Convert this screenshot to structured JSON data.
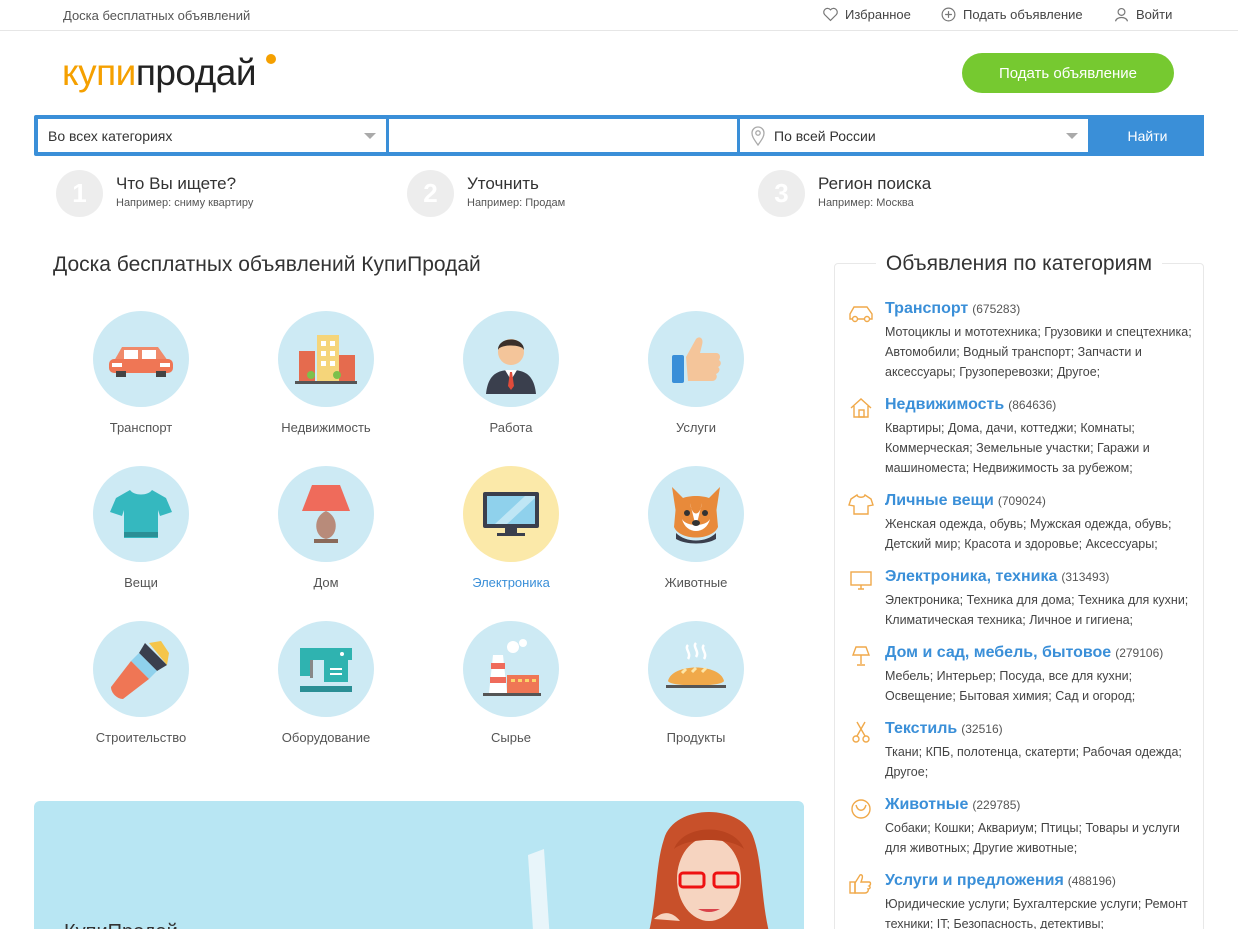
{
  "topbar": {
    "site_title": "Доска бесплатных объявлений",
    "favorites": "Избранное",
    "post_ad": "Подать объявление",
    "login": "Войти"
  },
  "logo": {
    "part1": "купи",
    "part2": "продай"
  },
  "header": {
    "post_button": "Подать объявление"
  },
  "search": {
    "category_value": "Во всех категориях",
    "query_value": "",
    "region_value": "По всей России",
    "submit": "Найти"
  },
  "steps": [
    {
      "num": "1",
      "title": "Что Вы ищете?",
      "hint": "Например: сниму квартиру"
    },
    {
      "num": "2",
      "title": "Уточнить",
      "hint": "Например: Продам"
    },
    {
      "num": "3",
      "title": "Регион поиска",
      "hint": "Например: Москва"
    }
  ],
  "main": {
    "heading": "Доска бесплатных объявлений КупиПродай",
    "categories": [
      {
        "label": "Транспорт",
        "icon": "car-icon"
      },
      {
        "label": "Недвижимость",
        "icon": "buildings-icon"
      },
      {
        "label": "Работа",
        "icon": "businessman-icon"
      },
      {
        "label": "Услуги",
        "icon": "thumbs-up-icon"
      },
      {
        "label": "Вещи",
        "icon": "tshirt-icon"
      },
      {
        "label": "Дом",
        "icon": "lamp-icon"
      },
      {
        "label": "Электроника",
        "icon": "monitor-icon"
      },
      {
        "label": "Животные",
        "icon": "dog-icon"
      },
      {
        "label": "Строительство",
        "icon": "paint-brush-icon"
      },
      {
        "label": "Оборудование",
        "icon": "machine-icon"
      },
      {
        "label": "Сырье",
        "icon": "factory-icon"
      },
      {
        "label": "Продукты",
        "icon": "bread-icon"
      }
    ]
  },
  "promo": {
    "text": "КупиПродай"
  },
  "sidebar": {
    "heading": "Объявления по категориям",
    "items": [
      {
        "title": "Транспорт",
        "count": "(675283)",
        "icon": "car-outline-icon",
        "subs": "Мотоциклы и мототехника; Грузовики и спецтехника; Автомобили; Водный транспорт; Запчасти и аксессуары; Грузоперевозки; Другое;"
      },
      {
        "title": "Недвижимость",
        "count": "(864636)",
        "icon": "house-outline-icon",
        "subs": "Квартиры; Дома, дачи, коттеджи; Комнаты; Коммерческая; Земельные участки; Гаражи и машиноместа; Недвижимость за рубежом;"
      },
      {
        "title": "Личные вещи",
        "count": "(709024)",
        "icon": "tshirt-outline-icon",
        "subs": "Женская одежда, обувь; Мужская одежда, обувь; Детский мир; Красота и здоровье; Аксессуары;"
      },
      {
        "title": "Электроника, техника",
        "count": "(313493)",
        "icon": "monitor-outline-icon",
        "subs": "Электроника; Техника для дома; Техника для кухни; Климатическая техника; Личное и гигиена;"
      },
      {
        "title": "Дом и сад, мебель, бытовое",
        "count": "(279106)",
        "icon": "lamp-outline-icon",
        "subs": "Мебель; Интерьер; Посуда, все для кухни; Освещение; Бытовая химия; Сад и огород;"
      },
      {
        "title": "Текстиль",
        "count": "(32516)",
        "icon": "scissors-outline-icon",
        "subs": "Ткани; КПБ, полотенца, скатерти; Рабочая одежда; Другое;"
      },
      {
        "title": "Животные",
        "count": "(229785)",
        "icon": "pet-outline-icon",
        "subs": "Собаки; Кошки; Аквариум; Птицы; Товары и услуги для животных; Другие животные;"
      },
      {
        "title": "Услуги и предложения",
        "count": "(488196)",
        "icon": "thumbs-up-outline-icon",
        "subs": "Юридические услуги; Бухгалтерские услуги; Ремонт техники; IT; Безопасность, детективы;"
      }
    ]
  },
  "colors": {
    "accent": "#3a8fd8",
    "brand_orange": "#f5a000",
    "green": "#76c930",
    "circle": "#cdeaf4",
    "circle_active": "#fbe9a9"
  }
}
